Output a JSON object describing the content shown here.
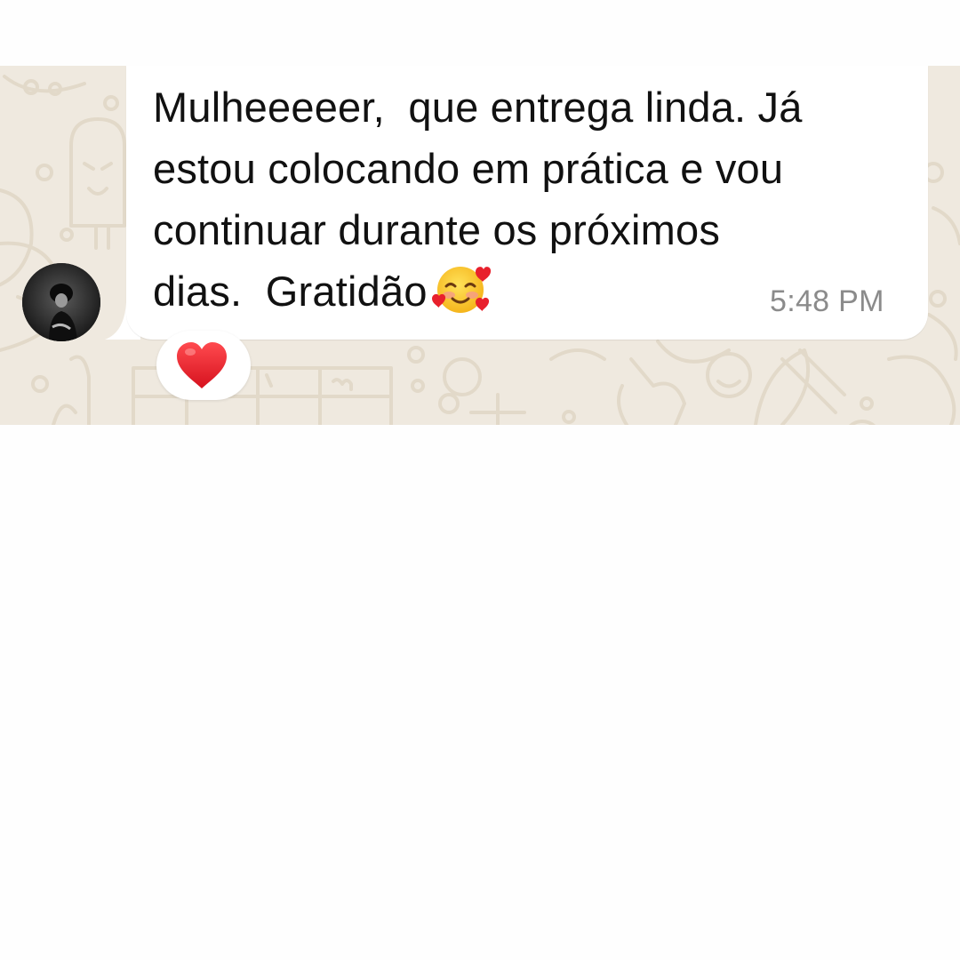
{
  "chat": {
    "message": {
      "text": "Mulheeeeer,  que entrega linda. Já estou colocando em prática e vou continuar durante os próximos dias.  Gratidão",
      "lines": [
        "Mulheeeeer,  que entrega linda. Já",
        "estou colocando em prática e vou",
        "continuar durante os próximos",
        "dias.  Gratidão"
      ],
      "emoji": "smiling-face-with-hearts-icon",
      "time": "5:48 PM"
    },
    "reaction": {
      "emoji": "red-heart-icon"
    },
    "sender_avatar": "avatar"
  },
  "colors": {
    "wallpaper": "#efe9df",
    "doodle_stroke": "#e2d9c9",
    "bubble": "#ffffff",
    "text": "#111111",
    "timestamp": "#8b8b8b",
    "heart": "#e0242f"
  }
}
